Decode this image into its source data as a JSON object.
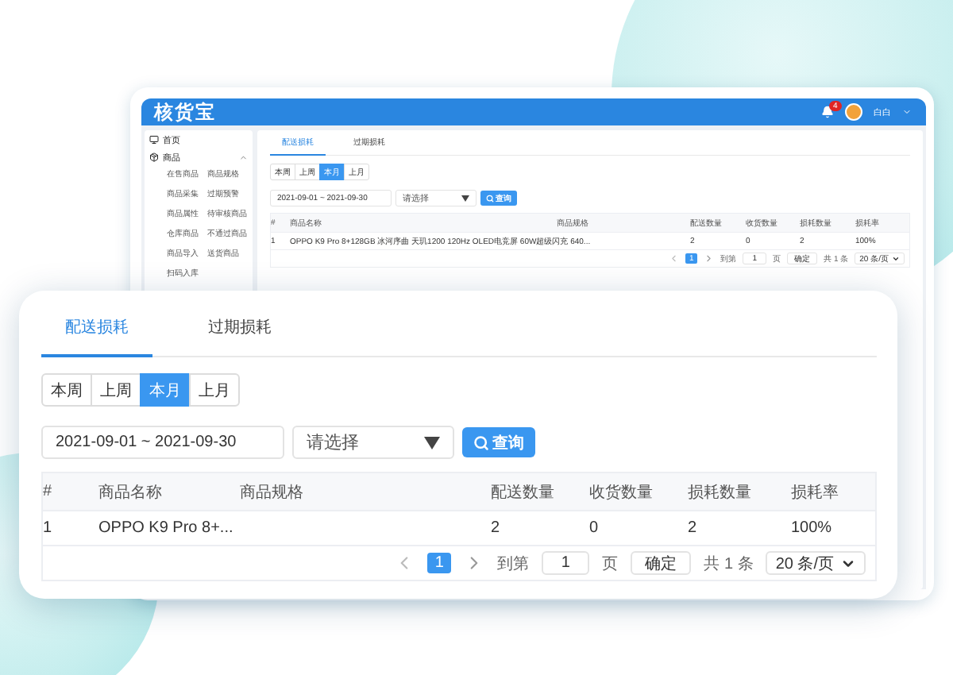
{
  "app_window": {
    "logo": "核货宝",
    "notifications": {
      "count": "4"
    },
    "user": {
      "name": "白白"
    },
    "sidebar": {
      "items": [
        {
          "label": "首页",
          "kind": "link"
        },
        {
          "label": "商品",
          "kind": "group",
          "expanded": true,
          "children": [
            {
              "label": "在售商品"
            },
            {
              "label": "商品规格"
            },
            {
              "label": "商品采集"
            },
            {
              "label": "过期预警"
            },
            {
              "label": "商品属性"
            },
            {
              "label": "待审核商品"
            },
            {
              "label": "仓库商品"
            },
            {
              "label": "不通过商品"
            },
            {
              "label": "商品导入"
            },
            {
              "label": "送货商品"
            },
            {
              "label": "扫码入库"
            }
          ]
        }
      ]
    },
    "panel": {
      "tabs": [
        {
          "label": "配送损耗",
          "selected": true
        },
        {
          "label": "过期损耗",
          "selected": false
        }
      ],
      "periods": [
        {
          "label": "本周",
          "selected": false
        },
        {
          "label": "上周",
          "selected": false
        },
        {
          "label": "本月",
          "selected": true
        },
        {
          "label": "上月",
          "selected": false
        }
      ],
      "date_range": "2021-09-01 ~ 2021-09-30",
      "select": {
        "placeholder": "请选择"
      },
      "query_button": "查询",
      "table": {
        "columns": [
          "#",
          "商品名称",
          "商品规格",
          "配送数量",
          "收货数量",
          "损耗数量",
          "损耗率"
        ],
        "rows": [
          {
            "index": "1",
            "name": "OPPO K9 Pro 8+128GB 冰河序曲 天玑1200 120Hz OLED电竞屏 60W超级闪充 640...",
            "delivered": "2",
            "received": "0",
            "lost": "2",
            "rate": "100%"
          }
        ]
      },
      "pagination": {
        "pages": [
          {
            "label": "1",
            "selected": true
          }
        ],
        "goto_label": "到第",
        "goto_value": "1",
        "page_unit": "页",
        "confirm": "确定",
        "total": "共 1 条",
        "page_size": "20 条/页"
      }
    }
  },
  "zoom_card": {
    "tabs": [
      {
        "label": "配送损耗",
        "selected": true
      },
      {
        "label": "过期损耗",
        "selected": false
      }
    ],
    "periods": [
      {
        "label": "本周",
        "selected": false
      },
      {
        "label": "上周",
        "selected": false
      },
      {
        "label": "本月",
        "selected": true
      },
      {
        "label": "上月",
        "selected": false
      }
    ],
    "date_range": "2021-09-01 ~ 2021-09-30",
    "select": {
      "placeholder": "请选择"
    },
    "query_button": "查询",
    "table": {
      "columns": [
        "#",
        "商品名称",
        "商品规格",
        "配送数量",
        "收货数量",
        "损耗数量",
        "损耗率"
      ],
      "rows": [
        {
          "index": "1",
          "name": "OPPO K9 Pro 8+...",
          "delivered": "2",
          "received": "0",
          "lost": "2",
          "rate": "100%"
        }
      ]
    },
    "pagination": {
      "pages": [
        {
          "label": "1",
          "selected": true
        }
      ],
      "goto_label": "到第",
      "goto_value": "1",
      "page_unit": "页",
      "confirm": "确定",
      "total": "共 1 条",
      "page_size": "20 条/页"
    }
  }
}
